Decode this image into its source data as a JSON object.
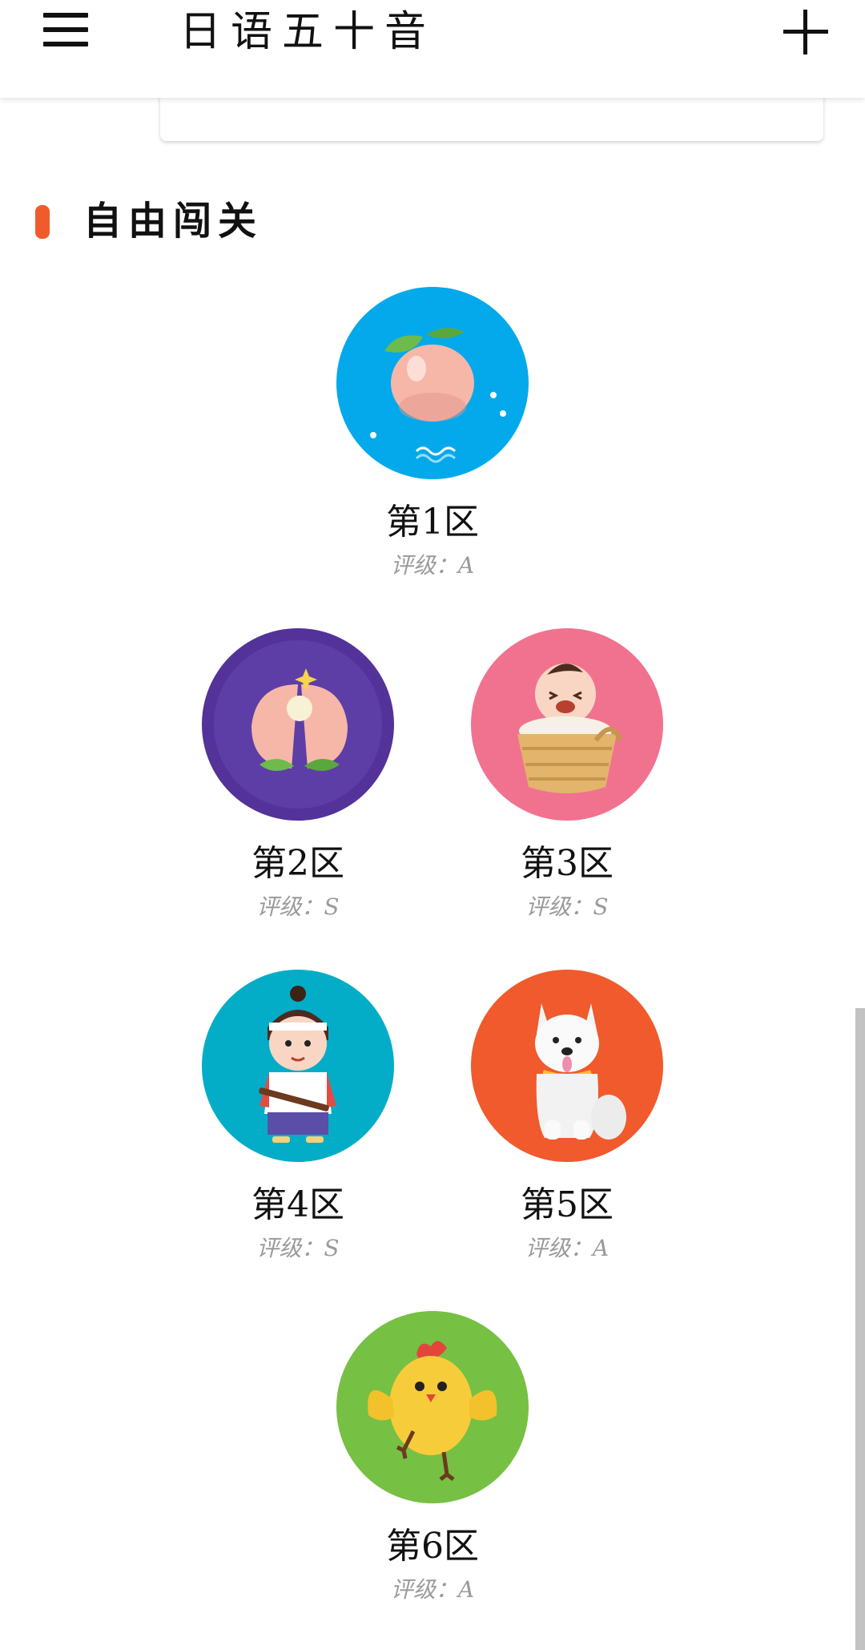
{
  "header": {
    "title": "日语五十音"
  },
  "section": {
    "title": "自由闯关"
  },
  "levels": [
    {
      "name": "第1区",
      "grade_label": "评级：",
      "grade": "A",
      "color": "#04a9ec",
      "icon": "peach-icon"
    },
    {
      "name": "第2区",
      "grade_label": "评级：",
      "grade": "S",
      "color": "#53329a",
      "icon": "split-peach-icon"
    },
    {
      "name": "第3区",
      "grade_label": "评级：",
      "grade": "S",
      "color": "#f1728f",
      "icon": "baby-in-basket-icon"
    },
    {
      "name": "第4区",
      "grade_label": "评级：",
      "grade": "S",
      "color": "#04adc7",
      "icon": "momotaro-boy-icon"
    },
    {
      "name": "第5区",
      "grade_label": "评级：",
      "grade": "A",
      "color": "#f05a2c",
      "icon": "white-dog-icon"
    },
    {
      "name": "第6区",
      "grade_label": "评级：",
      "grade": "A",
      "color": "#76c043",
      "icon": "chick-icon"
    }
  ],
  "colors": {
    "accent": "#f05a2c",
    "grade_text": "#9a9a9a"
  }
}
